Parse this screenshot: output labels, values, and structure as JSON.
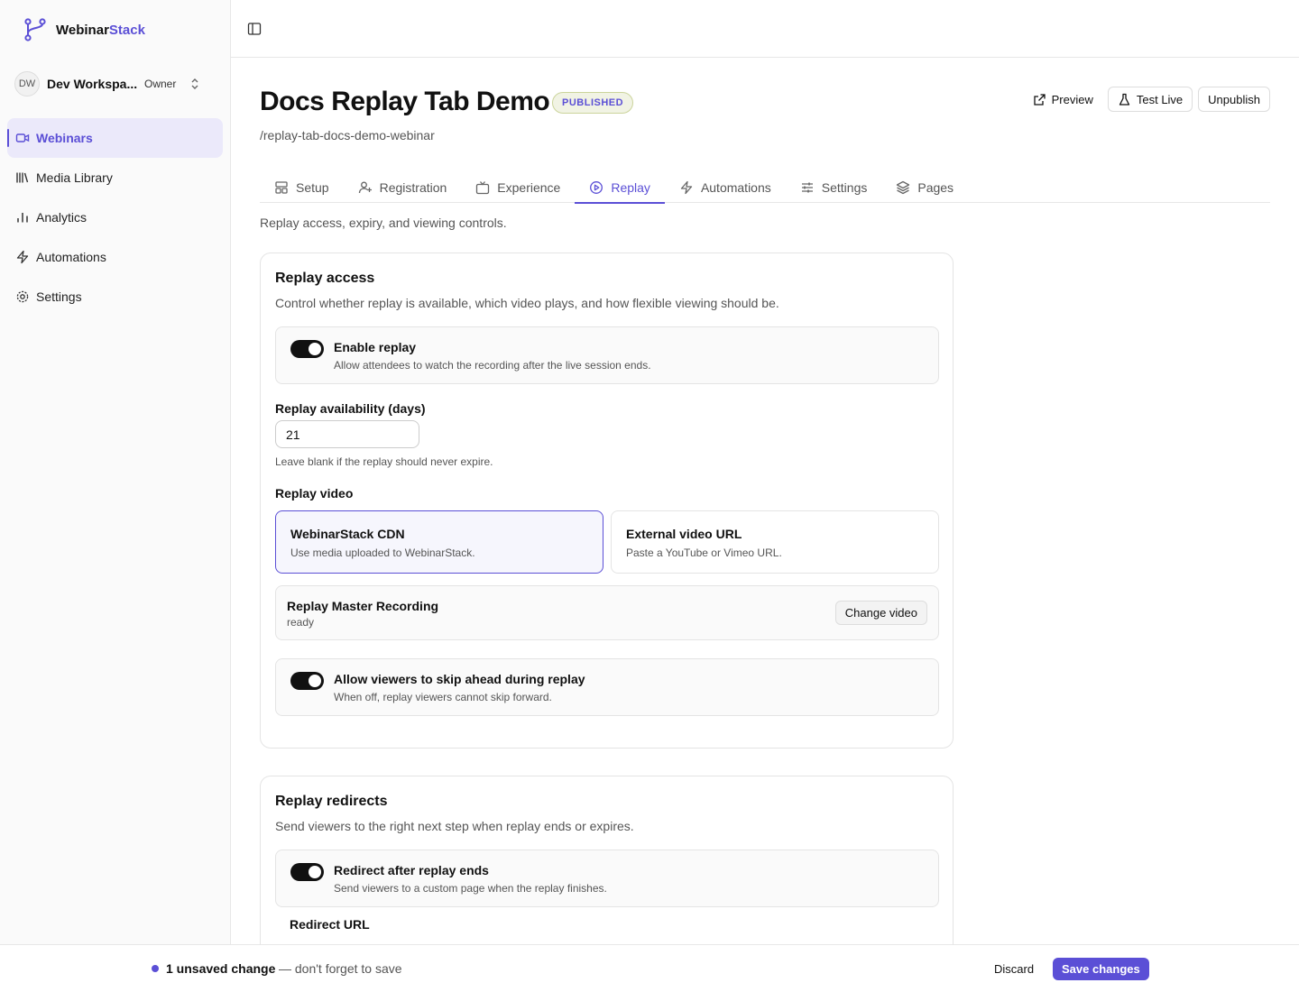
{
  "brand": {
    "name_prefix": "Webinar",
    "name_suffix": "Stack",
    "accent": "#5b4fd6"
  },
  "workspace": {
    "initials": "DW",
    "name": "Dev Workspa...",
    "role": "Owner"
  },
  "sidebar": {
    "items": [
      {
        "label": "Webinars",
        "icon": "video-icon",
        "active": true
      },
      {
        "label": "Media Library",
        "icon": "library-icon",
        "active": false
      },
      {
        "label": "Analytics",
        "icon": "bar-chart-icon",
        "active": false
      },
      {
        "label": "Automations",
        "icon": "zap-icon",
        "active": false
      },
      {
        "label": "Settings",
        "icon": "gear-icon",
        "active": false
      }
    ]
  },
  "header": {
    "title": "Docs Replay Tab Demo",
    "status_badge": "PUBLISHED",
    "slug": "/replay-tab-docs-demo-webinar",
    "actions": {
      "preview": "Preview",
      "test_live": "Test Live",
      "unpublish": "Unpublish"
    }
  },
  "tabs": [
    {
      "label": "Setup",
      "icon": "layout-icon",
      "active": false
    },
    {
      "label": "Registration",
      "icon": "user-plus-icon",
      "active": false
    },
    {
      "label": "Experience",
      "icon": "tv-icon",
      "active": false
    },
    {
      "label": "Replay",
      "icon": "play-circle-icon",
      "active": true
    },
    {
      "label": "Automations",
      "icon": "zap-icon",
      "active": false
    },
    {
      "label": "Settings",
      "icon": "sliders-icon",
      "active": false
    },
    {
      "label": "Pages",
      "icon": "layers-icon",
      "active": false
    }
  ],
  "tab_description": "Replay access, expiry, and viewing controls.",
  "replay_access": {
    "title": "Replay access",
    "subtitle": "Control whether replay is available, which video plays, and how flexible viewing should be.",
    "enable_replay": {
      "title": "Enable replay",
      "description": "Allow attendees to watch the recording after the live session ends.",
      "on": true
    },
    "availability": {
      "label": "Replay availability (days)",
      "value": "21",
      "help": "Leave blank if the replay should never expire."
    },
    "video_label": "Replay video",
    "video_options": [
      {
        "title": "WebinarStack CDN",
        "description": "Use media uploaded to WebinarStack.",
        "selected": true
      },
      {
        "title": "External video URL",
        "description": "Paste a YouTube or Vimeo URL.",
        "selected": false
      }
    ],
    "recording": {
      "title": "Replay Master Recording",
      "status": "ready",
      "change_label": "Change video"
    },
    "skip_ahead": {
      "title": "Allow viewers to skip ahead during replay",
      "description": "When off, replay viewers cannot skip forward.",
      "on": true
    }
  },
  "replay_redirects": {
    "title": "Replay redirects",
    "subtitle": "Send viewers to the right next step when replay ends or expires.",
    "redirect_after": {
      "title": "Redirect after replay ends",
      "description": "Send viewers to a custom page when the replay finishes.",
      "on": true
    },
    "redirect_url_label": "Redirect URL"
  },
  "footer": {
    "unsaved": "1 unsaved change",
    "note": "— don't forget to save",
    "discard": "Discard",
    "save": "Save changes"
  }
}
